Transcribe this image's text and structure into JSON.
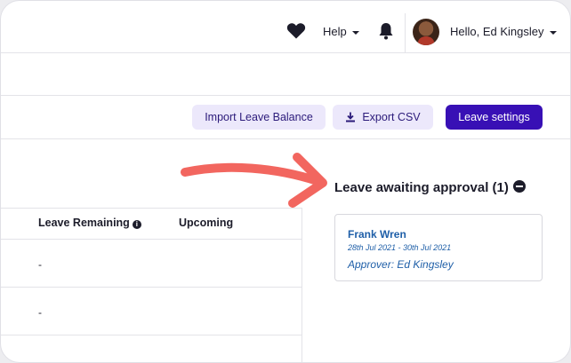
{
  "header": {
    "help_label": "Help",
    "greeting": "Hello, Ed Kingsley"
  },
  "toolbar": {
    "import_label": "Import Leave Balance",
    "export_label": "Export CSV",
    "settings_label": "Leave settings"
  },
  "table": {
    "columns": [
      "Leave Remaining",
      "Upcoming"
    ],
    "rows": [
      {
        "leave_remaining": "-"
      },
      {
        "leave_remaining": "-"
      }
    ]
  },
  "awaiting": {
    "title": "Leave awaiting approval (1)",
    "requests": [
      {
        "name": "Frank Wren",
        "dates": "28th Jul 2021 - 30th Jul 2021",
        "approver": "Approver: Ed Kingsley"
      }
    ]
  },
  "colors": {
    "primary": "#3810b5",
    "secondary_bg": "#ece8fb",
    "link": "#1f5fa8",
    "annotation_arrow": "#f2665f"
  },
  "icons": [
    "heart-icon",
    "bell-icon",
    "download-icon",
    "info-icon",
    "minus-circle-icon",
    "caret-down-icon"
  ]
}
